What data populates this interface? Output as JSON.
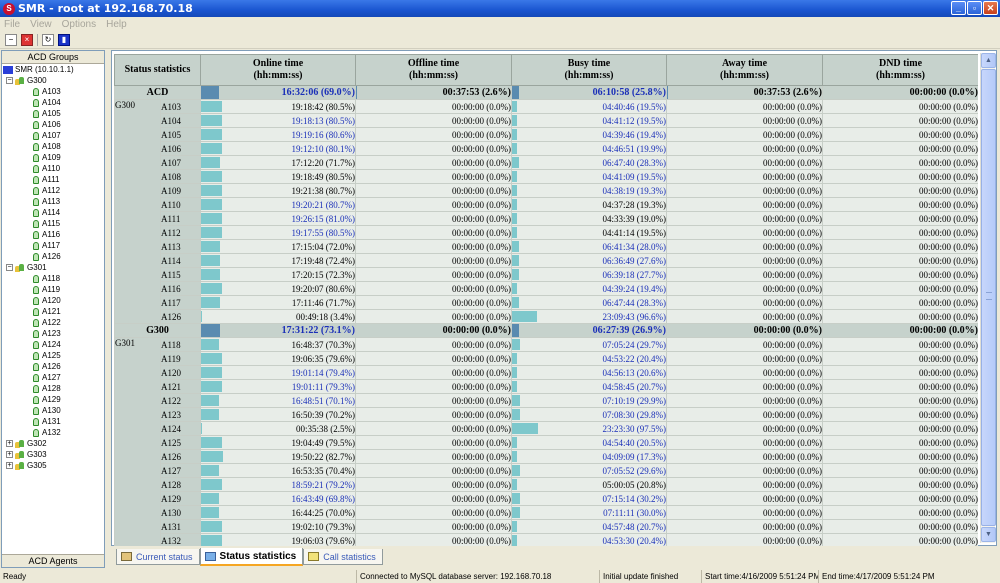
{
  "window": {
    "title": "SMR - root at 192.168.70.18",
    "app_icon_label": "S"
  },
  "menu": [
    "File",
    "View",
    "Options",
    "Help"
  ],
  "left_pane": {
    "header": "ACD Groups",
    "footer": "ACD Agents",
    "root": "SMR (10.10.1.1)",
    "groups": [
      {
        "name": "G300",
        "expanded": true,
        "agents": [
          "A103",
          "A104",
          "A105",
          "A106",
          "A107",
          "A108",
          "A109",
          "A110",
          "A111",
          "A112",
          "A113",
          "A114",
          "A115",
          "A116",
          "A117",
          "A126"
        ]
      },
      {
        "name": "G301",
        "expanded": true,
        "agents": [
          "A118",
          "A119",
          "A120",
          "A121",
          "A122",
          "A123",
          "A124",
          "A125",
          "A126",
          "A127",
          "A128",
          "A129",
          "A130",
          "A131",
          "A132"
        ]
      },
      {
        "name": "G302",
        "expanded": false,
        "agents": []
      },
      {
        "name": "G303",
        "expanded": false,
        "agents": []
      },
      {
        "name": "G305",
        "expanded": false,
        "agents": []
      }
    ]
  },
  "table": {
    "corner_header": "Status statistics",
    "columns": [
      {
        "title": "Online time",
        "unit": "(hh:mm:ss)"
      },
      {
        "title": "Offline time",
        "unit": "(hh:mm:ss)"
      },
      {
        "title": "Busy time",
        "unit": "(hh:mm:ss)"
      },
      {
        "title": "Away time",
        "unit": "(hh:mm:ss)"
      },
      {
        "title": "DND time",
        "unit": "(hh:mm:ss)"
      }
    ],
    "acd_summary": {
      "label": "ACD",
      "cells": [
        {
          "text": "16:32:06 (69.0%)",
          "pct": 69.0,
          "hilite": true
        },
        {
          "text": "00:37:53 (2.6%)",
          "pct": 2.6,
          "hilite": false
        },
        {
          "text": "06:10:58 (25.8%)",
          "pct": 25.8,
          "hilite": true
        },
        {
          "text": "00:37:53 (2.6%)",
          "pct": 2.6,
          "hilite": false
        },
        {
          "text": "00:00:00 (0.0%)",
          "pct": 0.0,
          "hilite": false
        }
      ]
    },
    "groups": [
      {
        "name": "G300",
        "rows": [
          {
            "agent": "A103",
            "online": "19:18:42 (80.5%)",
            "online_pct": 80.5,
            "offline": "00:00:00 (0.0%)",
            "busy": "04:40:46 (19.5%)",
            "busy_pct": 19.5,
            "away": "00:00:00 (0.0%)",
            "dnd": "00:00:00 (0.0%)",
            "online_hi": false,
            "busy_hi": true
          },
          {
            "agent": "A104",
            "online": "19:18:13 (80.5%)",
            "online_pct": 80.5,
            "offline": "00:00:00 (0.0%)",
            "busy": "04:41:12 (19.5%)",
            "busy_pct": 19.5,
            "away": "00:00:00 (0.0%)",
            "dnd": "00:00:00 (0.0%)",
            "online_hi": true,
            "busy_hi": true
          },
          {
            "agent": "A105",
            "online": "19:19:16 (80.6%)",
            "online_pct": 80.6,
            "offline": "00:00:00 (0.0%)",
            "busy": "04:39:46 (19.4%)",
            "busy_pct": 19.4,
            "away": "00:00:00 (0.0%)",
            "dnd": "00:00:00 (0.0%)",
            "online_hi": true,
            "busy_hi": true
          },
          {
            "agent": "A106",
            "online": "19:12:10 (80.1%)",
            "online_pct": 80.1,
            "offline": "00:00:00 (0.0%)",
            "busy": "04:46:51 (19.9%)",
            "busy_pct": 19.9,
            "away": "00:00:00 (0.0%)",
            "dnd": "00:00:00 (0.0%)",
            "online_hi": true,
            "busy_hi": true
          },
          {
            "agent": "A107",
            "online": "17:12:20 (71.7%)",
            "online_pct": 71.7,
            "offline": "00:00:00 (0.0%)",
            "busy": "06:47:40 (28.3%)",
            "busy_pct": 28.3,
            "away": "00:00:00 (0.0%)",
            "dnd": "00:00:00 (0.0%)",
            "online_hi": false,
            "busy_hi": true
          },
          {
            "agent": "A108",
            "online": "19:18:49 (80.5%)",
            "online_pct": 80.5,
            "offline": "00:00:00 (0.0%)",
            "busy": "04:41:09 (19.5%)",
            "busy_pct": 19.5,
            "away": "00:00:00 (0.0%)",
            "dnd": "00:00:00 (0.0%)",
            "online_hi": false,
            "busy_hi": true
          },
          {
            "agent": "A109",
            "online": "19:21:38 (80.7%)",
            "online_pct": 80.7,
            "offline": "00:00:00 (0.0%)",
            "busy": "04:38:19 (19.3%)",
            "busy_pct": 19.3,
            "away": "00:00:00 (0.0%)",
            "dnd": "00:00:00 (0.0%)",
            "online_hi": false,
            "busy_hi": true
          },
          {
            "agent": "A110",
            "online": "19:20:21 (80.7%)",
            "online_pct": 80.7,
            "offline": "00:00:00 (0.0%)",
            "busy": "04:37:28 (19.3%)",
            "busy_pct": 19.3,
            "away": "00:00:00 (0.0%)",
            "dnd": "00:00:00 (0.0%)",
            "online_hi": true,
            "busy_hi": false
          },
          {
            "agent": "A111",
            "online": "19:26:15 (81.0%)",
            "online_pct": 81.0,
            "offline": "00:00:00 (0.0%)",
            "busy": "04:33:39 (19.0%)",
            "busy_pct": 19.0,
            "away": "00:00:00 (0.0%)",
            "dnd": "00:00:00 (0.0%)",
            "online_hi": true,
            "busy_hi": false
          },
          {
            "agent": "A112",
            "online": "19:17:55 (80.5%)",
            "online_pct": 80.5,
            "offline": "00:00:00 (0.0%)",
            "busy": "04:41:14 (19.5%)",
            "busy_pct": 19.5,
            "away": "00:00:00 (0.0%)",
            "dnd": "00:00:00 (0.0%)",
            "online_hi": true,
            "busy_hi": false
          },
          {
            "agent": "A113",
            "online": "17:15:04 (72.0%)",
            "online_pct": 72.0,
            "offline": "00:00:00 (0.0%)",
            "busy": "06:41:34 (28.0%)",
            "busy_pct": 28.0,
            "away": "00:00:00 (0.0%)",
            "dnd": "00:00:00 (0.0%)",
            "online_hi": false,
            "busy_hi": true
          },
          {
            "agent": "A114",
            "online": "17:19:48 (72.4%)",
            "online_pct": 72.4,
            "offline": "00:00:00 (0.0%)",
            "busy": "06:36:49 (27.6%)",
            "busy_pct": 27.6,
            "away": "00:00:00 (0.0%)",
            "dnd": "00:00:00 (0.0%)",
            "online_hi": false,
            "busy_hi": true
          },
          {
            "agent": "A115",
            "online": "17:20:15 (72.3%)",
            "online_pct": 72.3,
            "offline": "00:00:00 (0.0%)",
            "busy": "06:39:18 (27.7%)",
            "busy_pct": 27.7,
            "away": "00:00:00 (0.0%)",
            "dnd": "00:00:00 (0.0%)",
            "online_hi": false,
            "busy_hi": true
          },
          {
            "agent": "A116",
            "online": "19:20:07 (80.6%)",
            "online_pct": 80.6,
            "offline": "00:00:00 (0.0%)",
            "busy": "04:39:24 (19.4%)",
            "busy_pct": 19.4,
            "away": "00:00:00 (0.0%)",
            "dnd": "00:00:00 (0.0%)",
            "online_hi": false,
            "busy_hi": true
          },
          {
            "agent": "A117",
            "online": "17:11:46 (71.7%)",
            "online_pct": 71.7,
            "offline": "00:00:00 (0.0%)",
            "busy": "06:47:44 (28.3%)",
            "busy_pct": 28.3,
            "away": "00:00:00 (0.0%)",
            "dnd": "00:00:00 (0.0%)",
            "online_hi": false,
            "busy_hi": true
          },
          {
            "agent": "A126",
            "online": "00:49:18 (3.4%)",
            "online_pct": 3.4,
            "offline": "00:00:00 (0.0%)",
            "busy": "23:09:43 (96.6%)",
            "busy_pct": 96.6,
            "away": "00:00:00 (0.0%)",
            "dnd": "00:00:00 (0.0%)",
            "online_hi": false,
            "busy_hi": true
          }
        ],
        "summary": {
          "label": "G300",
          "cells": [
            {
              "text": "17:31:22 (73.1%)",
              "pct": 73.1,
              "hilite": true
            },
            {
              "text": "00:00:00 (0.0%)",
              "pct": 0.0,
              "hilite": false
            },
            {
              "text": "06:27:39 (26.9%)",
              "pct": 26.9,
              "hilite": true
            },
            {
              "text": "00:00:00 (0.0%)",
              "pct": 0.0,
              "hilite": false
            },
            {
              "text": "00:00:00 (0.0%)",
              "pct": 0.0,
              "hilite": false
            }
          ]
        }
      },
      {
        "name": "G301",
        "rows": [
          {
            "agent": "A118",
            "online": "16:48:37 (70.3%)",
            "online_pct": 70.3,
            "offline": "00:00:00 (0.0%)",
            "busy": "07:05:24 (29.7%)",
            "busy_pct": 29.7,
            "away": "00:00:00 (0.0%)",
            "dnd": "00:00:00 (0.0%)",
            "online_hi": false,
            "busy_hi": true
          },
          {
            "agent": "A119",
            "online": "19:06:35 (79.6%)",
            "online_pct": 79.6,
            "offline": "00:00:00 (0.0%)",
            "busy": "04:53:22 (20.4%)",
            "busy_pct": 20.4,
            "away": "00:00:00 (0.0%)",
            "dnd": "00:00:00 (0.0%)",
            "online_hi": false,
            "busy_hi": true
          },
          {
            "agent": "A120",
            "online": "19:01:14 (79.4%)",
            "online_pct": 79.4,
            "offline": "00:00:00 (0.0%)",
            "busy": "04:56:13 (20.6%)",
            "busy_pct": 20.6,
            "away": "00:00:00 (0.0%)",
            "dnd": "00:00:00 (0.0%)",
            "online_hi": true,
            "busy_hi": true
          },
          {
            "agent": "A121",
            "online": "19:01:11 (79.3%)",
            "online_pct": 79.3,
            "offline": "00:00:00 (0.0%)",
            "busy": "04:58:45 (20.7%)",
            "busy_pct": 20.7,
            "away": "00:00:00 (0.0%)",
            "dnd": "00:00:00 (0.0%)",
            "online_hi": true,
            "busy_hi": true
          },
          {
            "agent": "A122",
            "online": "16:48:51 (70.1%)",
            "online_pct": 70.1,
            "offline": "00:00:00 (0.0%)",
            "busy": "07:10:19 (29.9%)",
            "busy_pct": 29.9,
            "away": "00:00:00 (0.0%)",
            "dnd": "00:00:00 (0.0%)",
            "online_hi": true,
            "busy_hi": true
          },
          {
            "agent": "A123",
            "online": "16:50:39 (70.2%)",
            "online_pct": 70.2,
            "offline": "00:00:00 (0.0%)",
            "busy": "07:08:30 (29.8%)",
            "busy_pct": 29.8,
            "away": "00:00:00 (0.0%)",
            "dnd": "00:00:00 (0.0%)",
            "online_hi": false,
            "busy_hi": true
          },
          {
            "agent": "A124",
            "online": "00:35:38 (2.5%)",
            "online_pct": 2.5,
            "offline": "00:00:00 (0.0%)",
            "busy": "23:23:30 (97.5%)",
            "busy_pct": 97.5,
            "away": "00:00:00 (0.0%)",
            "dnd": "00:00:00 (0.0%)",
            "online_hi": false,
            "busy_hi": true
          },
          {
            "agent": "A125",
            "online": "19:04:49 (79.5%)",
            "online_pct": 79.5,
            "offline": "00:00:00 (0.0%)",
            "busy": "04:54:40 (20.5%)",
            "busy_pct": 20.5,
            "away": "00:00:00 (0.0%)",
            "dnd": "00:00:00 (0.0%)",
            "online_hi": false,
            "busy_hi": true
          },
          {
            "agent": "A126",
            "online": "19:50:22 (82.7%)",
            "online_pct": 82.7,
            "offline": "00:00:00 (0.0%)",
            "busy": "04:09:09 (17.3%)",
            "busy_pct": 17.3,
            "away": "00:00:00 (0.0%)",
            "dnd": "00:00:00 (0.0%)",
            "online_hi": false,
            "busy_hi": true
          },
          {
            "agent": "A127",
            "online": "16:53:35 (70.4%)",
            "online_pct": 70.4,
            "offline": "00:00:00 (0.0%)",
            "busy": "07:05:52 (29.6%)",
            "busy_pct": 29.6,
            "away": "00:00:00 (0.0%)",
            "dnd": "00:00:00 (0.0%)",
            "online_hi": false,
            "busy_hi": true
          },
          {
            "agent": "A128",
            "online": "18:59:21 (79.2%)",
            "online_pct": 79.2,
            "offline": "00:00:00 (0.0%)",
            "busy": "05:00:05 (20.8%)",
            "busy_pct": 20.8,
            "away": "00:00:00 (0.0%)",
            "dnd": "00:00:00 (0.0%)",
            "online_hi": true,
            "busy_hi": false
          },
          {
            "agent": "A129",
            "online": "16:43:49 (69.8%)",
            "online_pct": 69.8,
            "offline": "00:00:00 (0.0%)",
            "busy": "07:15:14 (30.2%)",
            "busy_pct": 30.2,
            "away": "00:00:00 (0.0%)",
            "dnd": "00:00:00 (0.0%)",
            "online_hi": true,
            "busy_hi": true
          },
          {
            "agent": "A130",
            "online": "16:44:25 (70.0%)",
            "online_pct": 70.0,
            "offline": "00:00:00 (0.0%)",
            "busy": "07:11:11 (30.0%)",
            "busy_pct": 30.0,
            "away": "00:00:00 (0.0%)",
            "dnd": "00:00:00 (0.0%)",
            "online_hi": false,
            "busy_hi": true
          },
          {
            "agent": "A131",
            "online": "19:02:10 (79.3%)",
            "online_pct": 79.3,
            "offline": "00:00:00 (0.0%)",
            "busy": "04:57:48 (20.7%)",
            "busy_pct": 20.7,
            "away": "00:00:00 (0.0%)",
            "dnd": "00:00:00 (0.0%)",
            "online_hi": false,
            "busy_hi": true
          },
          {
            "agent": "A132",
            "online": "19:06:03 (79.6%)",
            "online_pct": 79.6,
            "offline": "00:00:00 (0.0%)",
            "busy": "04:53:30 (20.4%)",
            "busy_pct": 20.4,
            "away": "00:00:00 (0.0%)",
            "dnd": "00:00:00 (0.0%)",
            "online_hi": false,
            "busy_hi": true
          }
        ]
      }
    ]
  },
  "tabs": [
    {
      "label": "Current status",
      "active": false,
      "icon": "status-icon"
    },
    {
      "label": "Status statistics",
      "active": true,
      "icon": "chart-icon"
    },
    {
      "label": "Call statistics",
      "active": false,
      "icon": "call-icon"
    }
  ],
  "statusbar": {
    "ready": "Ready",
    "connection": "Connected to MySQL database server: 192.168.70.18",
    "update": "Initial update finished",
    "start": "Start time:4/16/2009 5:51:24 PM",
    "end": "End time:4/17/2009 5:51:24 PM"
  },
  "colors": {
    "bar_cell": "#7ec8cc",
    "bar_summary": "#5a8bb0",
    "header_bg": "#c6d2cc",
    "hilite_text": "#1a2fb8"
  }
}
